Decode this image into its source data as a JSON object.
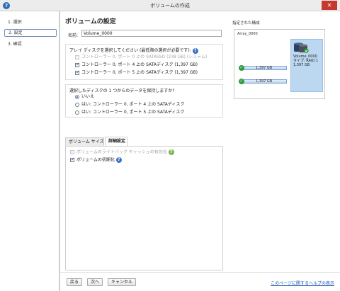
{
  "window": {
    "title": "ボリュームの作成",
    "close_label": "✕"
  },
  "steps": [
    {
      "label": "1. 選択",
      "active": false
    },
    {
      "label": "2. 設定",
      "active": true
    },
    {
      "label": "3. 確認",
      "active": false
    }
  ],
  "page": {
    "title": "ボリュームの設定",
    "name_label": "名前:",
    "name_value": "Volume_0000",
    "disk_select_prompt": "アレイ ディスクを選択してください (最低限の選択が必要です):",
    "disks": [
      {
        "label": "コントローラー 0, ポート 0 上の SATASSD (238 GB) (システム)",
        "checked": false,
        "disabled": true
      },
      {
        "label": "コントローラー 0, ポート 4 上の SATAディスク (1,397 GB)",
        "checked": true,
        "disabled": false
      },
      {
        "label": "コントローラー 0, ポート 5 上の SATAディスク (1,397 GB)",
        "checked": true,
        "disabled": false
      }
    ],
    "keep_data_prompt": "選択したディスクの 1 つからのデータを保持しますか?",
    "keep_options": [
      {
        "label": "いいえ",
        "checked": true
      },
      {
        "label": "はい: コントローラー 0, ポート 4 上の SATAディスク",
        "checked": false
      },
      {
        "label": "はい: コントローラー 0, ポート 5 上の SATAディスク",
        "checked": false
      }
    ],
    "tabs": [
      {
        "label": "ボリューム サイズ",
        "active": false
      },
      {
        "label": "詳細設定",
        "active": true
      }
    ],
    "advanced": {
      "write_back_label": "ボリュームのライトバック キャッシュの有効化",
      "write_back_checked": false,
      "initialize_label": "ボリュームの初期化",
      "initialize_checked": true
    }
  },
  "config_panel": {
    "title": "指定された構成",
    "array_name": "Array_0000",
    "disks": [
      {
        "size": "1,397 GB"
      },
      {
        "size": "1,397 GB"
      }
    ],
    "volume": {
      "name": "Volume_0000",
      "type": "タイプ: RAID 1",
      "size": "1,397 GB"
    }
  },
  "footer": {
    "back": "戻る",
    "next": "次へ",
    "cancel": "キャンセル",
    "help_link": "このページに関するヘルプの表示"
  },
  "colors": {
    "accent": "#3b73c6",
    "selected_volume": "#bcd7f0",
    "close": "#c7392c",
    "ok": "#2d9a3d"
  }
}
